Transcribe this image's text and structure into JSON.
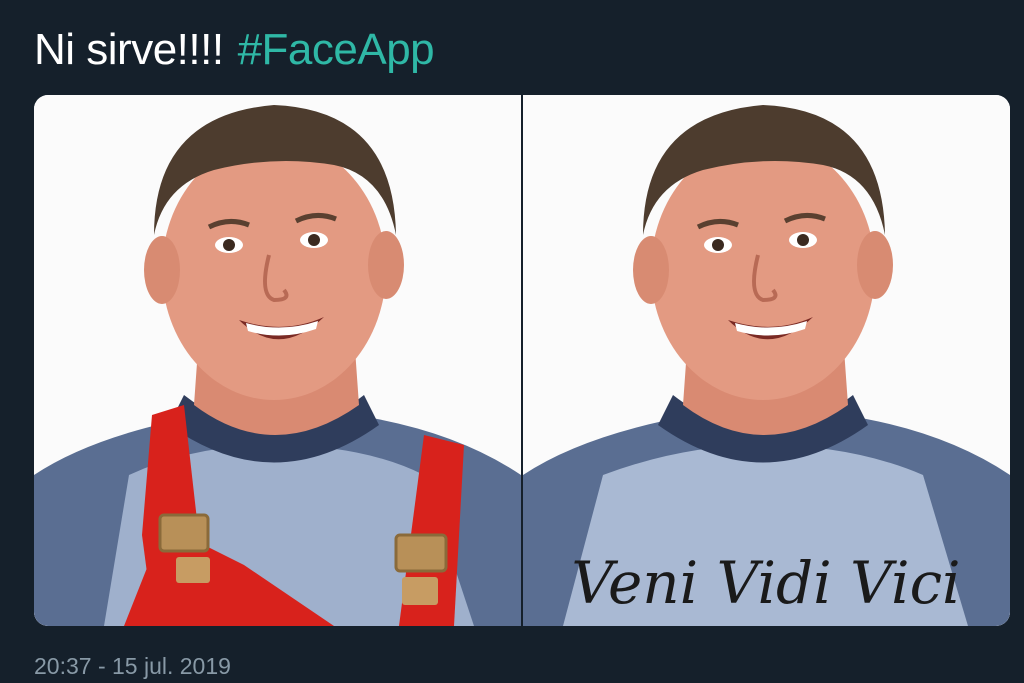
{
  "tweet": {
    "text": "Ni sirve!!!!",
    "hashtag": "#FaceApp",
    "timestamp": "20:37 - 15 jul. 2019"
  },
  "media": {
    "photos": [
      {
        "alt": "Original photo: smiling man wearing raglan shirt with red overall straps"
      },
      {
        "alt": "Edited photo: same man wearing shirt with script lettering"
      }
    ],
    "shirt_lettering": "Veni Vidi Vici"
  },
  "colors": {
    "background": "#15202b",
    "hashtag": "#2fb8a6",
    "timestamp": "#8899a6"
  }
}
